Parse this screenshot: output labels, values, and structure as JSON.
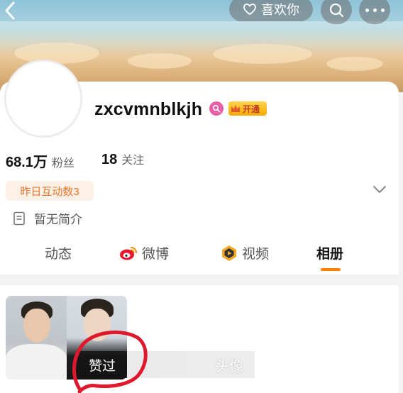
{
  "header": {
    "like_label": "喜欢你"
  },
  "profile": {
    "username": "zxcvmnblkjh",
    "vip_label": "开通",
    "stats": [
      {
        "value": "68.1万",
        "label": "粉丝"
      },
      {
        "value": "18",
        "label": "关注"
      }
    ],
    "interaction_tag": "昨日互动数3",
    "intro": "暂无简介"
  },
  "tabs": [
    {
      "label": "动态",
      "icon": "none"
    },
    {
      "label": "微博",
      "icon": "weibo-icon"
    },
    {
      "label": "视频",
      "icon": "video-icon"
    },
    {
      "label": "相册",
      "icon": "none",
      "active": true
    }
  ],
  "album": {
    "items": [
      {
        "caption": "赞过"
      },
      {
        "caption": "头像"
      }
    ]
  },
  "colors": {
    "accent_orange": "#ff8200",
    "tag_text": "#e8772e",
    "tag_bg": "#fdf0e6",
    "annotation_red": "#e0182d"
  }
}
